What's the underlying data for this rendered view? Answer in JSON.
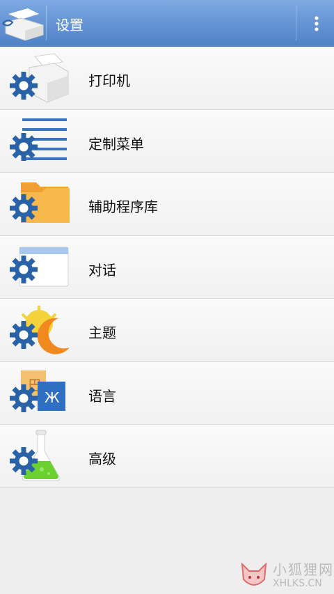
{
  "header": {
    "title": "设置",
    "menu_icon": "overflow-menu-icon"
  },
  "items": [
    {
      "label": "打印机",
      "icon": "printer-settings-icon"
    },
    {
      "label": "定制菜单",
      "icon": "menu-settings-icon"
    },
    {
      "label": "辅助程序库",
      "icon": "folder-settings-icon"
    },
    {
      "label": "对话",
      "icon": "dialog-settings-icon"
    },
    {
      "label": "主题",
      "icon": "theme-settings-icon"
    },
    {
      "label": "语言",
      "icon": "language-settings-icon"
    },
    {
      "label": "高级",
      "icon": "advanced-settings-icon"
    }
  ],
  "watermark": {
    "title": "小狐狸网",
    "url": "XHLKS.CN"
  },
  "colors": {
    "appbar": "#5f8fd2",
    "gear": "#2a62a8"
  }
}
